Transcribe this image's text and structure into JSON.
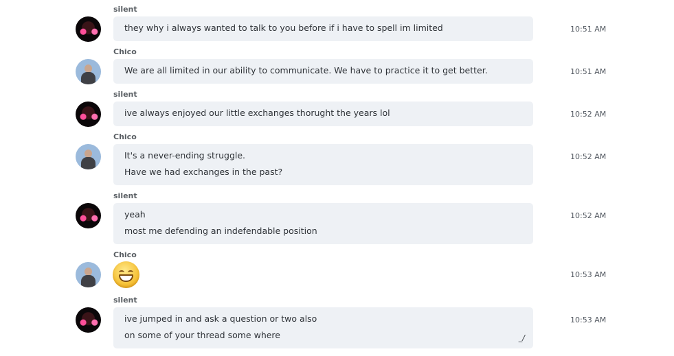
{
  "messages": [
    {
      "sender": "silent",
      "time": "10:51 AM",
      "lines": [
        "they why i always wanted to talk to you before if i have to spell im limited"
      ]
    },
    {
      "sender": "Chico",
      "time": "10:51 AM",
      "lines": [
        "We are all limited in our ability to communicate.  We have to practice it to get better."
      ]
    },
    {
      "sender": "silent",
      "time": "10:52 AM",
      "lines": [
        "ive always enjoyed our little exchanges thorught the years lol"
      ]
    },
    {
      "sender": "Chico",
      "time": "10:52 AM",
      "lines": [
        "It's a never-ending struggle.",
        "Have we had exchanges in the past?"
      ]
    },
    {
      "sender": "silent",
      "time": "10:52 AM",
      "lines": [
        "yeah",
        "most me defending an indefendable position"
      ]
    },
    {
      "sender": "Chico",
      "time": "10:53 AM",
      "emoji": "grinning-smiley"
    },
    {
      "sender": "silent",
      "time": "10:53 AM",
      "lines": [
        "ive jumped in and ask a question or two also",
        "on some of your thread some where"
      ],
      "edit_icon": "pencil-edit-icon"
    }
  ]
}
